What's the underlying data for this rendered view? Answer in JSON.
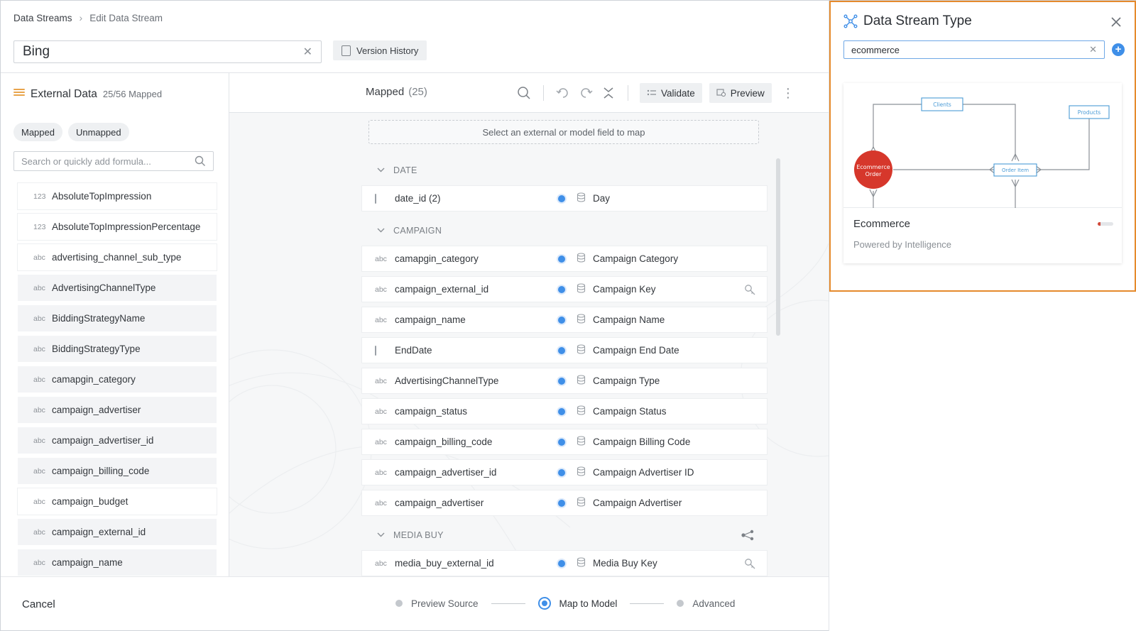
{
  "breadcrumb": {
    "root": "Data Streams",
    "current": "Edit Data Stream"
  },
  "stream_name": "Bing",
  "version_history_label": "Version History",
  "external": {
    "title": "External Data",
    "count": "25/56 Mapped",
    "tabs": [
      "Mapped",
      "Unmapped"
    ],
    "search_placeholder": "Search or quickly add formula...",
    "items": [
      {
        "type": "123",
        "label": "AbsoluteTopImpression",
        "highlight": true
      },
      {
        "type": "123",
        "label": "AbsoluteTopImpressionPercentage",
        "highlight": true
      },
      {
        "type": "abc",
        "label": "advertising_channel_sub_type",
        "highlight": true
      },
      {
        "type": "abc",
        "label": "AdvertisingChannelType",
        "highlight": false
      },
      {
        "type": "abc",
        "label": "BiddingStrategyName",
        "highlight": false
      },
      {
        "type": "abc",
        "label": "BiddingStrategyType",
        "highlight": false
      },
      {
        "type": "abc",
        "label": "camapgin_category",
        "highlight": false
      },
      {
        "type": "abc",
        "label": "campaign_advertiser",
        "highlight": false
      },
      {
        "type": "abc",
        "label": "campaign_advertiser_id",
        "highlight": false
      },
      {
        "type": "abc",
        "label": "campaign_billing_code",
        "highlight": false
      },
      {
        "type": "abc",
        "label": "campaign_budget",
        "highlight": true
      },
      {
        "type": "abc",
        "label": "campaign_external_id",
        "highlight": false
      },
      {
        "type": "abc",
        "label": "campaign_name",
        "highlight": false
      }
    ]
  },
  "mapped": {
    "title": "Mapped",
    "count": "(25)",
    "validate_label": "Validate",
    "preview_label": "Preview",
    "dropzone_text": "Select an external or model field to map",
    "groups": [
      {
        "name": "DATE",
        "rows": [
          {
            "type": "cal",
            "source": "date_id (2)",
            "target": "Day",
            "icon": ""
          }
        ]
      },
      {
        "name": "CAMPAIGN",
        "rows": [
          {
            "type": "abc",
            "source": "camapgin_category",
            "target": "Campaign Category",
            "icon": ""
          },
          {
            "type": "abc",
            "source": "campaign_external_id",
            "target": "Campaign Key",
            "icon": "key"
          },
          {
            "type": "abc",
            "source": "campaign_name",
            "target": "Campaign Name",
            "icon": ""
          },
          {
            "type": "cal",
            "source": "EndDate",
            "target": "Campaign End Date",
            "icon": ""
          },
          {
            "type": "abc",
            "source": "AdvertisingChannelType",
            "target": "Campaign Type",
            "icon": ""
          },
          {
            "type": "abc",
            "source": "campaign_status",
            "target": "Campaign Status",
            "icon": ""
          },
          {
            "type": "abc",
            "source": "campaign_billing_code",
            "target": "Campaign Billing Code",
            "icon": ""
          },
          {
            "type": "abc",
            "source": "campaign_advertiser_id",
            "target": "Campaign Advertiser ID",
            "icon": ""
          },
          {
            "type": "abc",
            "source": "campaign_advertiser",
            "target": "Campaign Advertiser",
            "icon": ""
          }
        ]
      },
      {
        "name": "MEDIA BUY",
        "rows": [
          {
            "type": "abc",
            "source": "media_buy_external_id",
            "target": "Media Buy Key",
            "icon": "key"
          }
        ]
      }
    ]
  },
  "footer": {
    "cancel_label": "Cancel",
    "steps": [
      {
        "label": "Preview Source",
        "active": false
      },
      {
        "label": "Map to Model",
        "active": true
      },
      {
        "label": "Advanced",
        "active": false
      }
    ]
  },
  "drawer": {
    "title": "Data Stream Type",
    "search_value": "ecommerce",
    "card": {
      "name": "Ecommerce",
      "subtitle": "Powered by Intelligence",
      "diagram": {
        "clients": "Clients",
        "products": "Products",
        "order": "Ecommerce Order",
        "order_item": "Order Item"
      }
    }
  },
  "colors": {
    "accent": "#3f8fe8",
    "drawer_border": "#e58a2c",
    "order_node": "#d6372b",
    "diagram_box": "#4a9bd6"
  }
}
